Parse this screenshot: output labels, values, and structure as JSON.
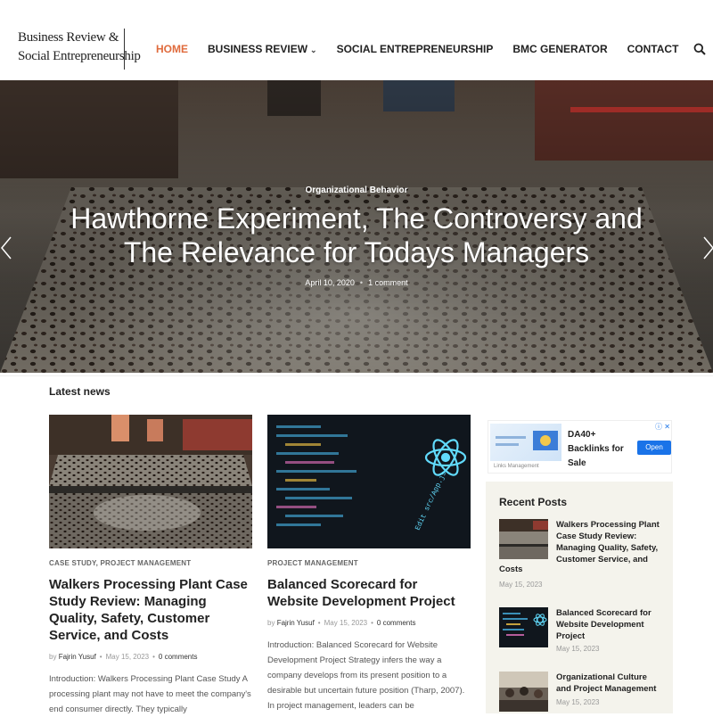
{
  "header": {
    "logo_line1": "Business Review &",
    "logo_line2": "Social Entrepreneurship",
    "nav": [
      {
        "label": "HOME",
        "active": true
      },
      {
        "label": "BUSINESS REVIEW",
        "dropdown": true
      },
      {
        "label": "SOCIAL ENTREPRENEURSHIP"
      },
      {
        "label": "BMC GENERATOR"
      },
      {
        "label": "CONTACT"
      }
    ],
    "search_icon": "search-icon"
  },
  "hero": {
    "category": "Organizational Behavior",
    "title": "Hawthorne Experiment, The Controversy and The Relevance for Todays Managers",
    "date": "April 10, 2020",
    "comments": "1 comment"
  },
  "section": {
    "title": "Latest news"
  },
  "cards": [
    {
      "category": "CASE STUDY, PROJECT MANAGEMENT",
      "title": "Walkers Processing Plant Case Study Review: Managing Quality, Safety, Customer Service, and Costs",
      "author_prefix": "by",
      "author": "Fajrin Yusuf",
      "date": "May 15, 2023",
      "comments": "0 comments",
      "excerpt": "Introduction: Walkers Processing Plant Case Study A processing plant may not have to meet the company's end consumer directly. They typically"
    },
    {
      "category": "PROJECT MANAGEMENT",
      "title": "Balanced Scorecard for Website Development Project",
      "author_prefix": "by",
      "author": "Fajrin Yusuf",
      "date": "May 15, 2023",
      "comments": "0 comments",
      "excerpt": "Introduction: Balanced Scorecard for Website Development Project Strategy infers the way a company develops from its present position to a desirable but uncertain future position (Tharp, 2007). In project management, leaders can be"
    }
  ],
  "ad": {
    "line1": "DA40+",
    "line2": "Backlinks for",
    "line3": "Sale",
    "button": "Open",
    "brand": "Links Management"
  },
  "sidebar": {
    "title": "Recent Posts",
    "posts": [
      {
        "title": "Walkers Processing Plant Case Study Review: Managing Quality, Safety, Customer Service, and",
        "title_tail": "Costs",
        "date": "May 15, 2023"
      },
      {
        "title": "Balanced Scorecard for Website Development Project",
        "date": "May 15, 2023"
      },
      {
        "title": "Organizational Culture and Project Management",
        "date": "May 15, 2023"
      }
    ]
  },
  "colors": {
    "accent": "#e06b3d",
    "sidebar_bg": "#f4f3ec"
  }
}
